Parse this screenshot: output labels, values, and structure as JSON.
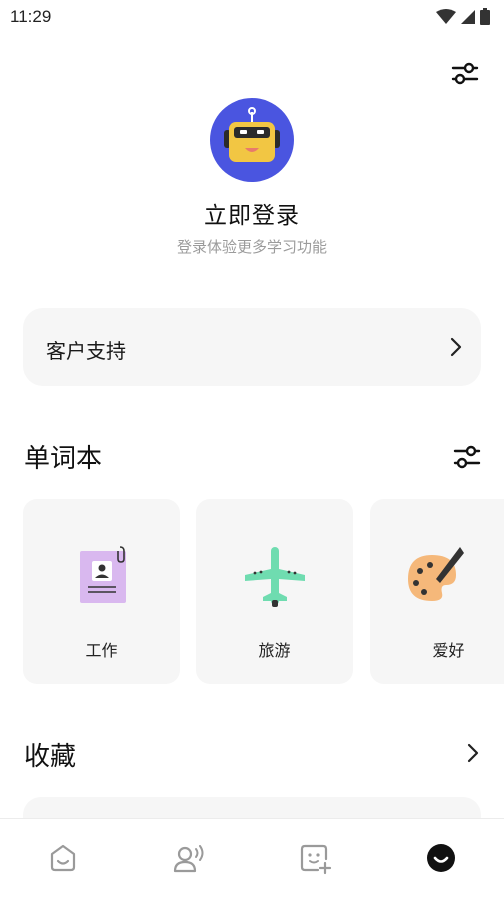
{
  "status_bar": {
    "time": "11:29"
  },
  "profile": {
    "title": "立即登录",
    "subtitle": "登录体验更多学习功能"
  },
  "support": {
    "label": "客户支持"
  },
  "vocab": {
    "title": "单词本",
    "items": [
      {
        "label": "工作",
        "icon": "work-id-card-icon"
      },
      {
        "label": "旅游",
        "icon": "airplane-icon"
      },
      {
        "label": "爱好",
        "icon": "paint-palette-icon"
      }
    ]
  },
  "favorites": {
    "title": "收藏"
  },
  "nav": {
    "items": [
      {
        "icon": "home-face-icon"
      },
      {
        "icon": "speaking-person-icon"
      },
      {
        "icon": "add-card-icon"
      },
      {
        "icon": "profile-face-icon",
        "active": true
      }
    ]
  },
  "colors": {
    "avatar_bg": "#4a55e0",
    "robot_yellow": "#f2c643",
    "card_bg": "#f6f6f6",
    "subtitle": "#9b9b9b"
  }
}
